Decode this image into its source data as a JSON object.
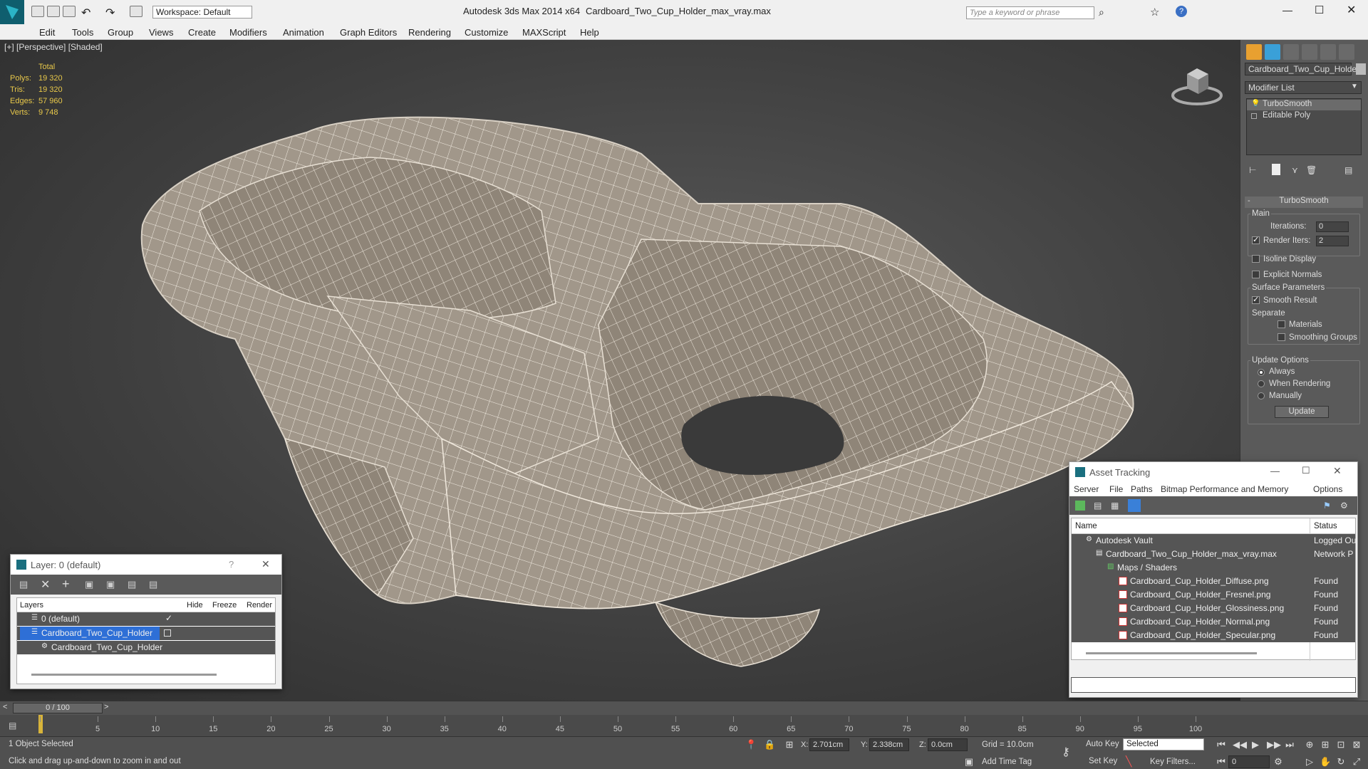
{
  "titlebar": {
    "app_title": "Autodesk 3ds Max  2014 x64",
    "file_name": "Cardboard_Two_Cup_Holder_max_vray.max",
    "workspace_label": "Workspace: Default",
    "search_placeholder": "Type a keyword or phrase"
  },
  "menu": [
    "Edit",
    "Tools",
    "Group",
    "Views",
    "Create",
    "Modifiers",
    "Animation",
    "Graph Editors",
    "Rendering",
    "Customize",
    "MAXScript",
    "Help"
  ],
  "viewport": {
    "label": "[+] [Perspective] [Shaded]",
    "stats": {
      "header": "Total",
      "rows": [
        {
          "label": "Polys:",
          "value": "19 320"
        },
        {
          "label": "Tris:",
          "value": "19 320"
        },
        {
          "label": "Edges:",
          "value": "57 960"
        },
        {
          "label": "Verts:",
          "value": "9 748"
        }
      ]
    }
  },
  "command_panel": {
    "object_name": "Cardboard_Two_Cup_Holder",
    "modifier_list": "Modifier List",
    "stack": [
      "TurboSmooth",
      "Editable Poly"
    ],
    "rollout_title": "TurboSmooth",
    "main_label": "Main",
    "iterations_label": "Iterations:",
    "iterations_value": "0",
    "render_iters_label": "Render Iters:",
    "render_iters_value": "2",
    "isoline_label": "Isoline Display",
    "explicit_normals_label": "Explicit Normals",
    "surface_params_label": "Surface Parameters",
    "smooth_result_label": "Smooth Result",
    "separate_label": "Separate",
    "materials_label": "Materials",
    "smoothing_groups_label": "Smoothing Groups",
    "update_options_label": "Update Options",
    "always_label": "Always",
    "when_rendering_label": "When Rendering",
    "manually_label": "Manually",
    "update_button": "Update"
  },
  "layer_window": {
    "title": "Layer: 0 (default)",
    "columns": [
      "Layers",
      "Hide",
      "Freeze",
      "Render"
    ],
    "rows": [
      "0 (default)",
      "Cardboard_Two_Cup_Holder",
      "Cardboard_Two_Cup_Holder"
    ]
  },
  "asset_window": {
    "title": "Asset Tracking",
    "menu": [
      "Server",
      "File",
      "Paths",
      "Bitmap Performance and Memory",
      "Options"
    ],
    "columns": [
      "Name",
      "Status"
    ],
    "rows": [
      {
        "name": "Autodesk Vault",
        "status": "Logged Ou"
      },
      {
        "name": "Cardboard_Two_Cup_Holder_max_vray.max",
        "status": "Network P"
      },
      {
        "name": "Maps / Shaders",
        "status": ""
      },
      {
        "name": "Cardboard_Cup_Holder_Diffuse.png",
        "status": "Found"
      },
      {
        "name": "Cardboard_Cup_Holder_Fresnel.png",
        "status": "Found"
      },
      {
        "name": "Cardboard_Cup_Holder_Glossiness.png",
        "status": "Found"
      },
      {
        "name": "Cardboard_Cup_Holder_Normal.png",
        "status": "Found"
      },
      {
        "name": "Cardboard_Cup_Holder_Specular.png",
        "status": "Found"
      }
    ]
  },
  "timeline": {
    "frame_counter": "0 / 100",
    "ticks": [
      "5",
      "10",
      "15",
      "20",
      "25",
      "30",
      "35",
      "40",
      "45",
      "50",
      "55",
      "60",
      "65",
      "70",
      "75",
      "80",
      "85",
      "90",
      "95",
      "100"
    ]
  },
  "statusbar": {
    "selection": "1 Object Selected",
    "prompt": "Click and drag up-and-down to zoom in and out",
    "x_label": "X:",
    "x_value": "2.701cm",
    "y_label": "Y:",
    "y_value": "2.338cm",
    "z_label": "Z:",
    "z_value": "0.0cm",
    "grid": "Grid = 10.0cm",
    "add_time_tag": "Add Time Tag",
    "auto_key": "Auto Key",
    "set_key": "Set Key",
    "selected_dropdown": "Selected",
    "key_filters": "Key Filters...",
    "frame_value": "0"
  }
}
